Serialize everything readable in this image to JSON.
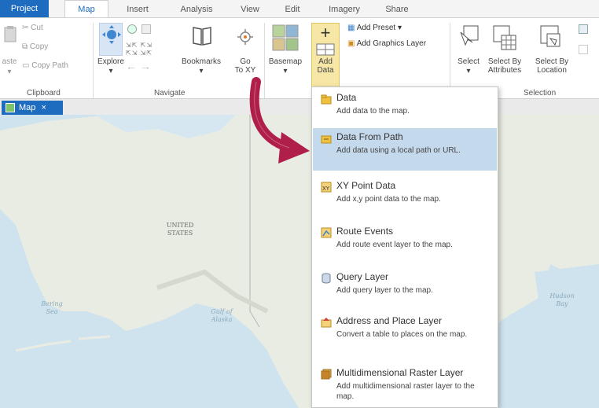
{
  "tabs": [
    {
      "label": "Project"
    },
    {
      "label": "Map"
    },
    {
      "label": "Insert"
    },
    {
      "label": "Analysis"
    },
    {
      "label": "View"
    },
    {
      "label": "Edit"
    },
    {
      "label": "Imagery"
    },
    {
      "label": "Share"
    }
  ],
  "ribbon": {
    "clipboard": {
      "group_label": "Clipboard",
      "paste": "aste",
      "cut": "Cut",
      "copy": "Copy",
      "copy_path": "Copy Path"
    },
    "navigate": {
      "group_label": "Navigate",
      "explore": "Explore",
      "bookmarks": "Bookmarks",
      "go_to_xy": "Go\nTo XY"
    },
    "layer": {
      "basemap": "Basemap",
      "add_data": "Add\nData",
      "add_preset": "Add Preset",
      "add_graphics_layer": "Add Graphics Layer"
    },
    "selection": {
      "group_label": "Selection",
      "select": "Select",
      "select_by_attributes": "Select By\nAttributes",
      "select_by_location": "Select By\nLocation"
    }
  },
  "map_tab": {
    "label": "Map",
    "close": "×"
  },
  "map_labels": {
    "country": "UNITED\nSTATES",
    "bering_sea": "Bering\nSea",
    "gulf_of_alaska": "Gulf of\nAlaska",
    "hudson_bay": "Hudson\nBay"
  },
  "add_data_menu": [
    {
      "title": "Data",
      "desc": "Add data to the map.",
      "icon": "folder-add-icon"
    },
    {
      "title": "Data From Path",
      "desc": "Add data using a local path or URL.",
      "icon": "folder-path-icon",
      "highlighted": true
    },
    {
      "title": "XY Point Data",
      "desc": "Add x,y point data to the map.",
      "icon": "xy-table-icon"
    },
    {
      "title": "Route Events",
      "desc": "Add route event layer to the map.",
      "icon": "route-events-icon"
    },
    {
      "title": "Query Layer",
      "desc": "Add query layer to the map.",
      "icon": "query-layer-icon"
    },
    {
      "title": "Address and Place Layer",
      "desc": "Convert a table to places on the map.",
      "icon": "address-place-icon"
    },
    {
      "title": "Multidimensional Raster Layer",
      "desc": "Add multidimensional raster layer to the map.",
      "icon": "multidimensional-raster-icon"
    }
  ],
  "colors": {
    "accent": "#1e6cc0",
    "highlight": "#c5d9ec",
    "arrow": "#b01f4a",
    "land": "#e9ece2",
    "water": "#cfe3ef"
  }
}
